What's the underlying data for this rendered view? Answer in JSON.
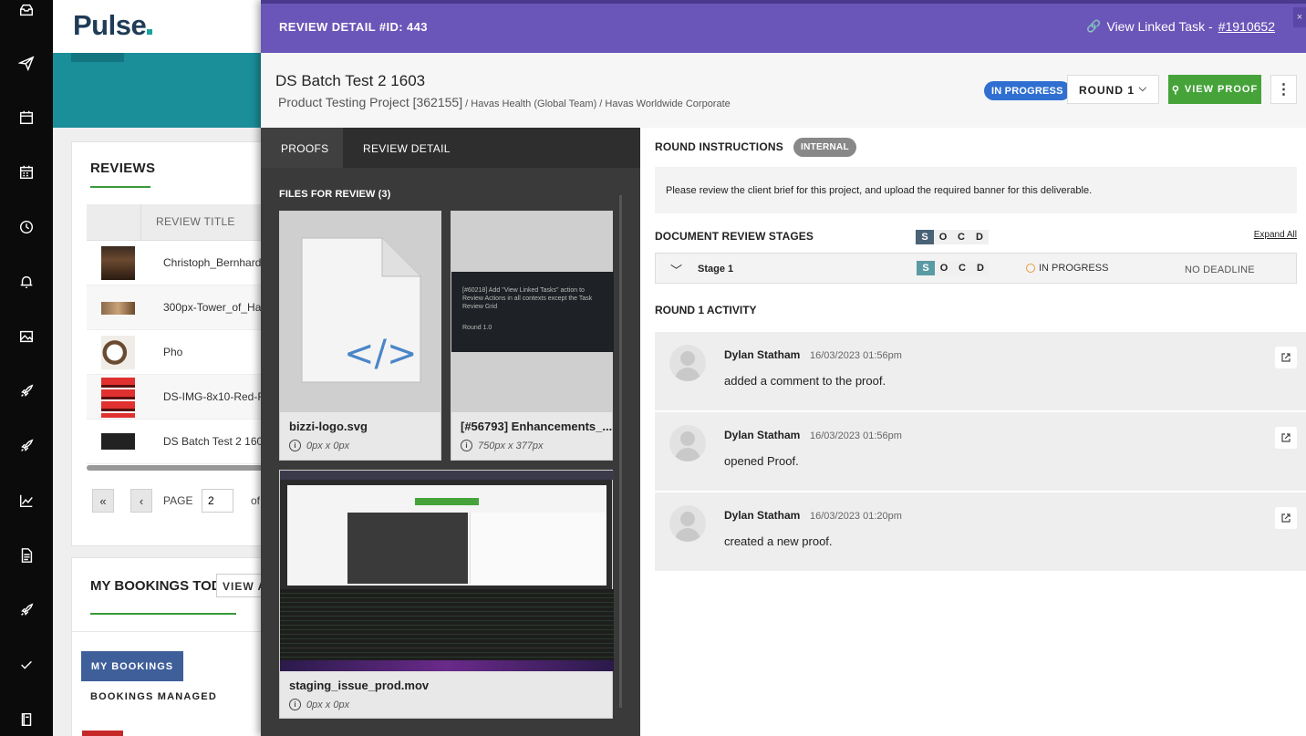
{
  "app": {
    "logo": "Pulse"
  },
  "rail": {
    "icons": [
      "inbox-icon",
      "send-icon",
      "calendar-icon",
      "calendar-grid-icon",
      "clock-icon",
      "bell-icon",
      "image-icon",
      "rocket-icon",
      "rocket-2-icon",
      "chart-icon",
      "document-icon",
      "rocket-3-icon",
      "check-icon",
      "book-icon"
    ]
  },
  "reviews": {
    "title": "REVIEWS",
    "column": "REVIEW TITLE",
    "rows": [
      "Christoph_Bernhard_",
      "300px-Tower_of_Ha",
      "Pho",
      "DS-IMG-8x10-Red-F",
      "DS Batch Test 2 160"
    ],
    "pager": {
      "first": "«",
      "prev": "‹",
      "label": "PAGE",
      "value": "2",
      "of": "of"
    }
  },
  "bookings": {
    "title": "MY BOOKINGS TODAY",
    "view": "VIEW A",
    "my": "MY BOOKINGS",
    "managed": "BOOKINGS MANAGED"
  },
  "modal": {
    "header": "REVIEW DETAIL #ID: 443",
    "linked_label": "View Linked Task -",
    "linked_id": "#1910652",
    "close": "×",
    "name": "DS Batch Test 2 1603",
    "project": "Product Testing Project [362155]",
    "crumb_sep": " / ",
    "crumb2": "Havas Health (Global Team)",
    "crumb3": "Havas Worldwide Corporate",
    "status": "IN PROGRESS",
    "round": "ROUND 1",
    "view_proof": "VIEW PROOF",
    "tabs": [
      "PROOFS",
      "REVIEW DETAIL"
    ],
    "files_label": "FILES FOR REVIEW (3)",
    "files": [
      {
        "name": "bizzi-logo.svg",
        "dim": "0px x 0px"
      },
      {
        "name": "[#56793] Enhancements_...",
        "dim": "750px x 377px",
        "preview_text": "[#60218] Add \"View Linked Tasks\" action to Review Actions in all contexts except the Task Review Grid",
        "preview_round": "Round 1.0"
      },
      {
        "name": "staging_issue_prod.mov",
        "dim": "0px x 0px"
      }
    ],
    "round_instructions": "ROUND INSTRUCTIONS",
    "internal": "INTERNAL",
    "instructions": "Please review the client brief for this project, and upload the required banner for this deliverable.",
    "stages_title": "DOCUMENT REVIEW STAGES",
    "socd": [
      "S",
      "O",
      "C",
      "D"
    ],
    "expand_all": "Expand All",
    "stage": {
      "name": "Stage 1",
      "status": "IN PROGRESS",
      "deadline": "NO DEADLINE"
    },
    "activity_title": "ROUND 1 ACTIVITY",
    "activity": [
      {
        "who": "Dylan Statham",
        "when": "16/03/2023 01:56pm",
        "what": "added a comment to the proof."
      },
      {
        "who": "Dylan Statham",
        "when": "16/03/2023 01:56pm",
        "what": "opened Proof."
      },
      {
        "who": "Dylan Statham",
        "when": "16/03/2023 01:20pm",
        "what": "created a new proof."
      }
    ]
  },
  "colors": {
    "header": "#6a55b8",
    "status_blue": "#2f6fd1",
    "green": "#45a33a",
    "teal": "#1a8e99"
  }
}
